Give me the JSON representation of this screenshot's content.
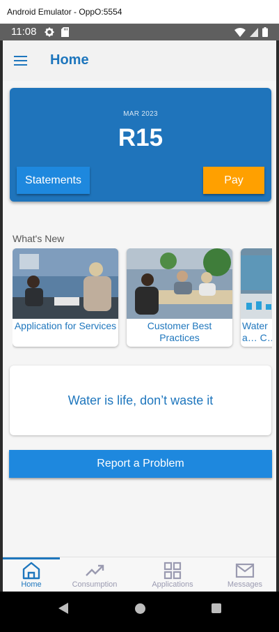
{
  "window": {
    "title": "Android Emulator - OppO:5554"
  },
  "status_bar": {
    "time": "11:08",
    "left_icons": [
      "settings-icon",
      "sd-card-icon"
    ],
    "right_icons": [
      "wifi-icon",
      "signal-icon",
      "battery-icon"
    ]
  },
  "app_bar": {
    "title": "Home",
    "menu_icon": "hamburger-menu-icon"
  },
  "balance": {
    "month": "MAR 2023",
    "amount": "R15",
    "statements_label": "Statements",
    "pay_label": "Pay"
  },
  "whats_new": {
    "heading": "What's New",
    "items": [
      {
        "label": "Application for Services"
      },
      {
        "label": "Customer Best Practices"
      },
      {
        "label": "Water a… C…"
      }
    ]
  },
  "slogan": {
    "text": "Water is life, don’t waste it"
  },
  "report": {
    "label": "Report a Problem"
  },
  "bottom_nav": {
    "items": [
      {
        "label": "Home",
        "icon": "home-icon",
        "active": true
      },
      {
        "label": "Consumption",
        "icon": "trending-up-icon",
        "active": false
      },
      {
        "label": "Applications",
        "icon": "grid-icon",
        "active": false
      },
      {
        "label": "Messages",
        "icon": "mail-icon",
        "active": false
      }
    ]
  },
  "colors": {
    "primary": "#1f74bb",
    "accent": "#ffa000",
    "button": "#1e88de",
    "nav_inactive": "#9a9ab0"
  }
}
